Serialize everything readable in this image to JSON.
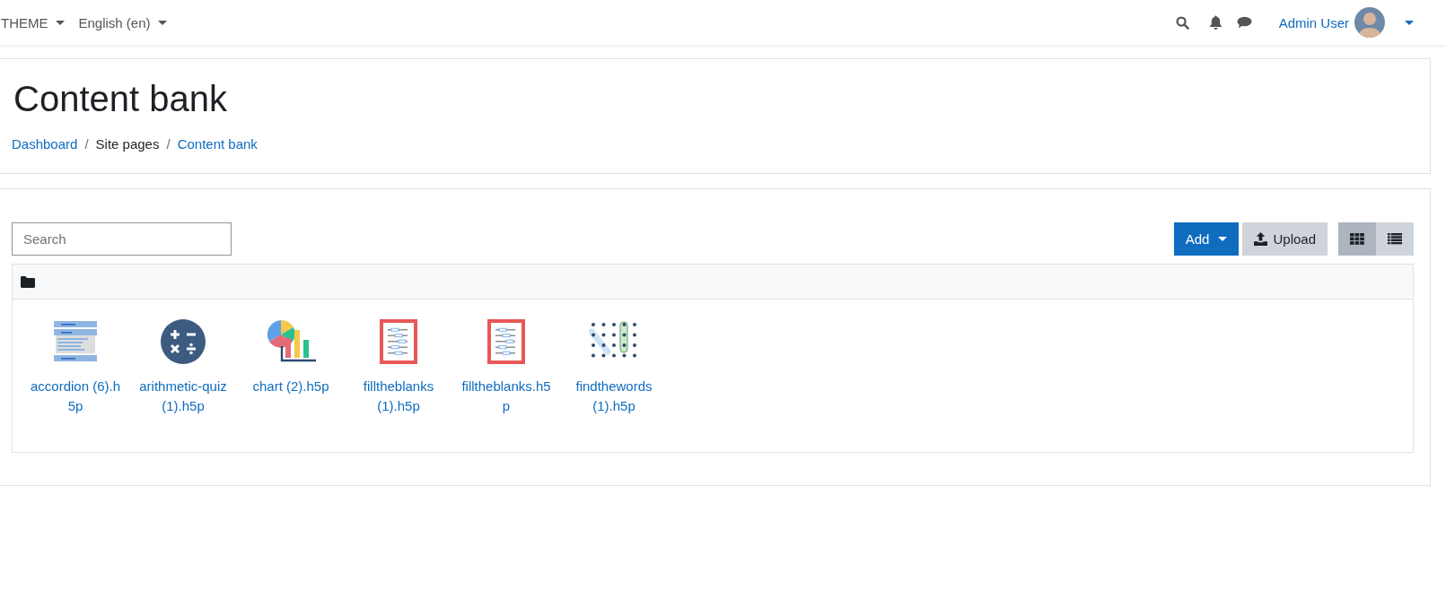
{
  "navbar": {
    "menus": [
      {
        "label": "THEME"
      },
      {
        "label": "English (en)"
      }
    ],
    "user": "Admin User"
  },
  "page_title": "Content bank",
  "breadcrumb_separator": "/",
  "breadcrumb": [
    {
      "label": "Dashboard",
      "link": true
    },
    {
      "label": "Site pages",
      "link": false
    },
    {
      "label": "Content bank",
      "link": true
    }
  ],
  "search": {
    "placeholder": "Search"
  },
  "actions": {
    "add": "Add",
    "upload": "Upload"
  },
  "views": [
    {
      "kind": "grid",
      "selected": true
    },
    {
      "kind": "list",
      "selected": false
    }
  ],
  "files": [
    {
      "kind": "accordion",
      "name": "accordion (6).h5p"
    },
    {
      "kind": "arithmetic",
      "name": "arithmetic-quiz (1).h5p"
    },
    {
      "kind": "chart",
      "name": "chart (2).h5p"
    },
    {
      "kind": "fillblanks",
      "name": "filltheblanks (1).h5p"
    },
    {
      "kind": "fillblanks",
      "name": "filltheblanks.h5p"
    },
    {
      "kind": "findwords",
      "name": "findthewords (1).h5p"
    }
  ]
}
